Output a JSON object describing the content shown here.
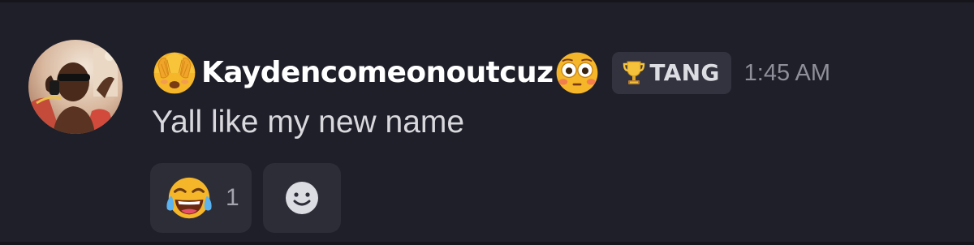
{
  "message": {
    "author": {
      "display_name": "Kaydencomeonoutcuz",
      "prefix_emoji": "see-no-evil-face-icon",
      "suffix_emoji": "flushed-face-icon"
    },
    "tag": {
      "icon": "trophy-icon",
      "label": "TANG"
    },
    "timestamp": "1:45 AM",
    "content": "Yall like my new name",
    "reactions": [
      {
        "emoji": "tears-of-joy-icon",
        "count": "1"
      }
    ],
    "add_reaction_icon": "add-reaction-smiley-icon"
  },
  "colors": {
    "background": "#1f1f2a",
    "username": "#ffffff",
    "message_text": "#d8d8dd",
    "timestamp": "#8e8f99",
    "tag_bg": "#333340",
    "reaction_bg": "#2d2d38"
  }
}
